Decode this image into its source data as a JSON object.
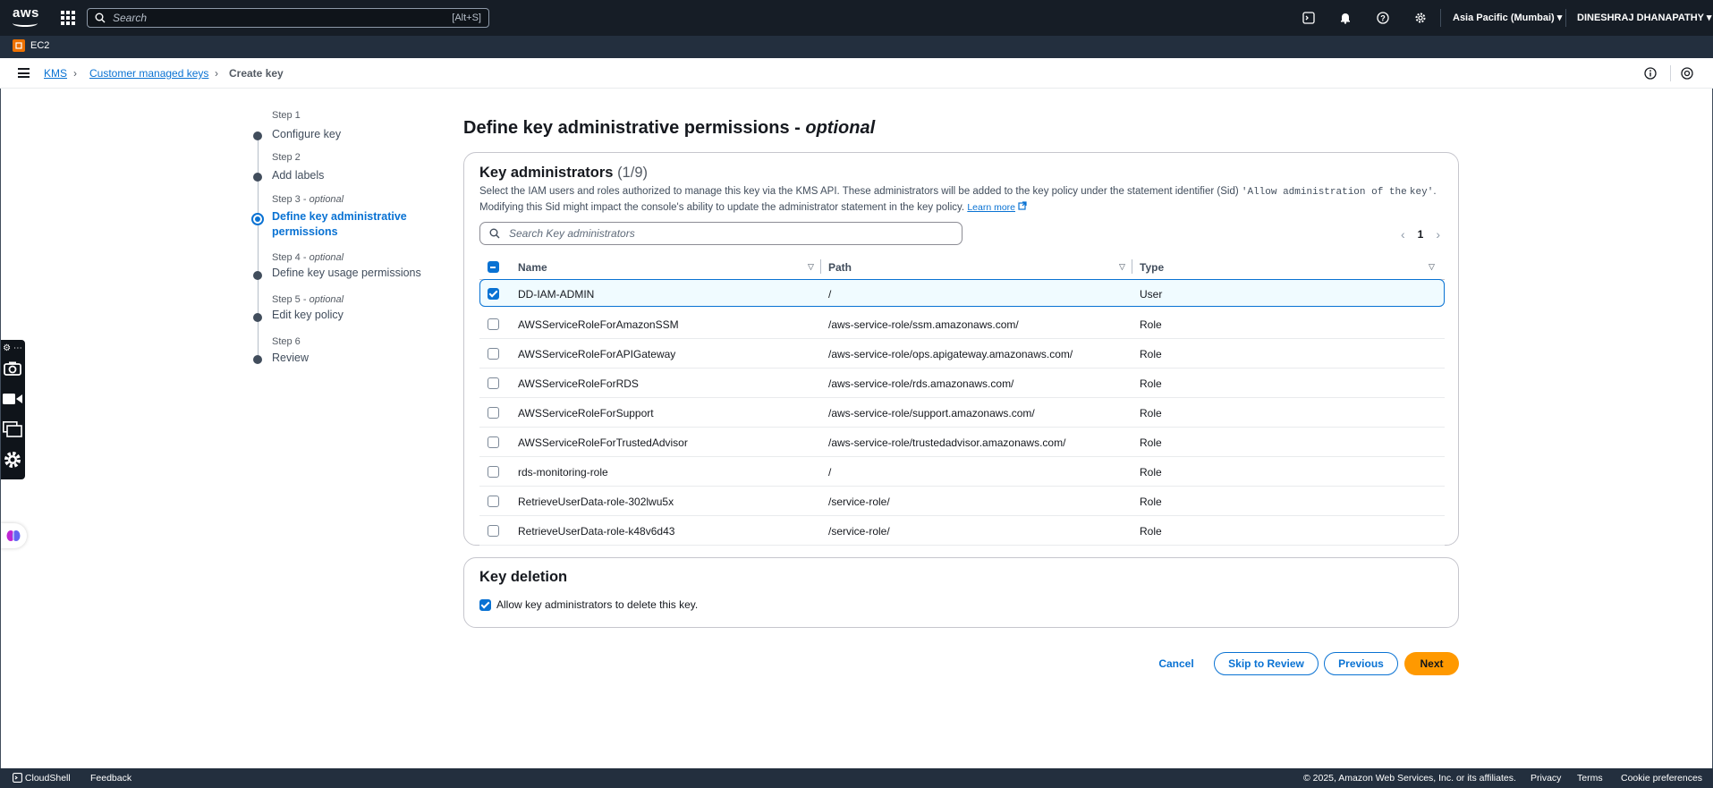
{
  "topnav": {
    "search_placeholder": "Search",
    "search_shortcut": "[Alt+S]",
    "region": "Asia Pacific (Mumbai) ▾",
    "user": "DINESHRAJ DHANAPATHY ▾"
  },
  "service_bar": {
    "service": "EC2"
  },
  "breadcrumb": {
    "items": [
      "KMS",
      "Customer managed keys",
      "Create key"
    ]
  },
  "steps": [
    {
      "label": "Step 1",
      "optional": "",
      "title": "Configure key"
    },
    {
      "label": "Step 2",
      "optional": "",
      "title": "Add labels"
    },
    {
      "label": "Step 3 - ",
      "optional": "optional",
      "title_line1": "Define key administrative",
      "title_line2": "permissions"
    },
    {
      "label": "Step 4 - ",
      "optional": "optional",
      "title": "Define key usage permissions"
    },
    {
      "label": "Step 5 - ",
      "optional": "optional",
      "title": "Edit key policy"
    },
    {
      "label": "Step 6",
      "optional": "",
      "title": "Review"
    }
  ],
  "page": {
    "title": "Define key administrative permissions - ",
    "title_optional": "optional"
  },
  "admins": {
    "heading": "Key administrators",
    "count": "(1/9)",
    "desc_1": "Select the IAM users and roles authorized to manage this key via the KMS API. These administrators will be added to the key policy under the statement identifier (Sid) ",
    "desc_code1": "'Allow administration of the",
    "desc_code2": "key'",
    "desc_2": ". Modifying this Sid might impact the console's ability to update the administrator statement in the key policy. ",
    "learn_more": "Learn more",
    "search_placeholder": "Search Key administrators",
    "page_number": "1",
    "columns": {
      "name": "Name",
      "path": "Path",
      "type": "Type"
    },
    "rows": [
      {
        "name": "DD-IAM-ADMIN",
        "path": "/",
        "type": "User",
        "checked": true
      },
      {
        "name": "AWSServiceRoleForAmazonSSM",
        "path": "/aws-service-role/ssm.amazonaws.com/",
        "type": "Role",
        "checked": false
      },
      {
        "name": "AWSServiceRoleForAPIGateway",
        "path": "/aws-service-role/ops.apigateway.amazonaws.com/",
        "type": "Role",
        "checked": false
      },
      {
        "name": "AWSServiceRoleForRDS",
        "path": "/aws-service-role/rds.amazonaws.com/",
        "type": "Role",
        "checked": false
      },
      {
        "name": "AWSServiceRoleForSupport",
        "path": "/aws-service-role/support.amazonaws.com/",
        "type": "Role",
        "checked": false
      },
      {
        "name": "AWSServiceRoleForTrustedAdvisor",
        "path": "/aws-service-role/trustedadvisor.amazonaws.com/",
        "type": "Role",
        "checked": false
      },
      {
        "name": "rds-monitoring-role",
        "path": "/",
        "type": "Role",
        "checked": false
      },
      {
        "name": "RetrieveUserData-role-302lwu5x",
        "path": "/service-role/",
        "type": "Role",
        "checked": false
      },
      {
        "name": "RetrieveUserData-role-k48v6d43",
        "path": "/service-role/",
        "type": "Role",
        "checked": false
      }
    ]
  },
  "deletion": {
    "heading": "Key deletion",
    "checkbox_label": "Allow key administrators to delete this key.",
    "checked": true
  },
  "buttons": {
    "cancel": "Cancel",
    "skip": "Skip to Review",
    "previous": "Previous",
    "next": "Next"
  },
  "footer": {
    "cloudshell": "CloudShell",
    "feedback": "Feedback",
    "copyright": "© 2025, Amazon Web Services, Inc. or its affiliates.",
    "privacy": "Privacy",
    "terms": "Terms",
    "cookie": "Cookie preferences"
  },
  "colors": {
    "nav_bg": "#161d26",
    "accent": "#0972d3",
    "primary_button": "#ff9900"
  }
}
